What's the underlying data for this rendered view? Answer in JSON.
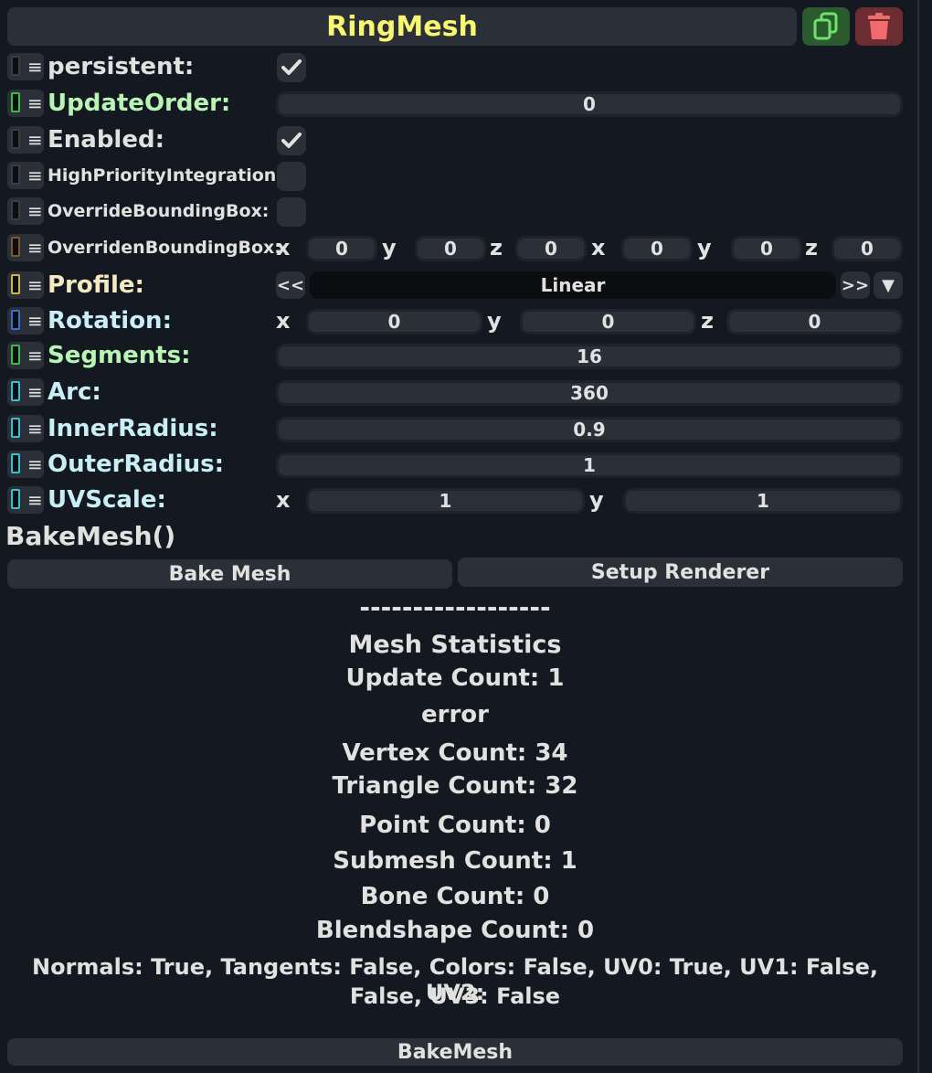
{
  "component": {
    "title": "RingMesh"
  },
  "colors": {
    "title": "#f8f771",
    "green_label": "#b8f5b5",
    "cyan_label": "#c8eef6",
    "yellow_label": "#f3e9c2",
    "white_label": "#e1e1e0",
    "background": "#141820",
    "panel": "#2b2f37"
  },
  "icons": {
    "duplicate": "duplicate-icon",
    "delete": "trash-icon",
    "check": "checkmark-icon",
    "menu": "hamburger-icon"
  },
  "fields": {
    "persistent": {
      "label": "persistent:",
      "checked": true
    },
    "update_order": {
      "label": "UpdateOrder:",
      "value": "0"
    },
    "enabled": {
      "label": "Enabled:",
      "checked": true
    },
    "high_priority": {
      "label": "HighPriorityIntegration:",
      "checked": false
    },
    "override_bbox": {
      "label": "OverrideBoundingBox:",
      "checked": false
    },
    "overriden_bbox": {
      "label": "OverridenBoundingBox:",
      "axes": [
        "x",
        "y",
        "z",
        "x",
        "y",
        "z"
      ],
      "values": [
        "0",
        "0",
        "0",
        "0",
        "0",
        "0"
      ]
    },
    "profile": {
      "label": "Profile:",
      "value": "Linear",
      "prev": "<<",
      "next": ">>",
      "dropdown": "▼"
    },
    "rotation": {
      "label": "Rotation:",
      "axes": [
        "x",
        "y",
        "z"
      ],
      "values": [
        "0",
        "0",
        "0"
      ]
    },
    "segments": {
      "label": "Segments:",
      "value": "16"
    },
    "arc": {
      "label": "Arc:",
      "value": "360"
    },
    "inner_radius": {
      "label": "InnerRadius:",
      "value": "0.9"
    },
    "outer_radius": {
      "label": "OuterRadius:",
      "value": "1"
    },
    "uv_scale": {
      "label": "UVScale:",
      "axes": [
        "x",
        "y"
      ],
      "values": [
        "1",
        "1"
      ]
    }
  },
  "bake": {
    "method_label": "BakeMesh()",
    "bake_button": "Bake Mesh",
    "setup_button": "Setup Renderer",
    "separator": "------------------",
    "stats_title": "Mesh Statistics",
    "update_count": "Update Count: 1",
    "error": "error",
    "vertex_count": "Vertex Count: 34",
    "triangle_count": "Triangle Count: 32",
    "point_count": "Point Count: 0",
    "submesh_count": "Submesh Count: 1",
    "bone_count": "Bone Count: 0",
    "blendshape_count": "Blendshape Count: 0",
    "attributes_line1": "Normals: True, Tangents: False, Colors: False, UV0: True, UV1: False, UV2:",
    "attributes_line2": "False, UV3: False",
    "bottom_button": "BakeMesh"
  }
}
